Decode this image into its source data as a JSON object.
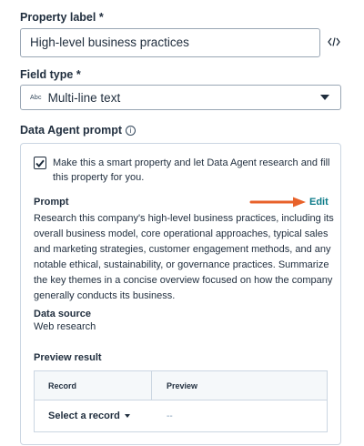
{
  "property_label": {
    "label": "Property label *",
    "value": "High-level business practices"
  },
  "field_type": {
    "label": "Field type *",
    "icon_text": "Abc",
    "value": "Multi-line text"
  },
  "agent": {
    "label": "Data Agent prompt",
    "smart_checkbox_checked": true,
    "smart_checkbox_text": "Make this a smart property and let Data Agent research and fill this property for you.",
    "prompt_title": "Prompt",
    "edit_label": "Edit",
    "prompt_text": "Research this company's high-level business practices, including its overall business model, core operational approaches, typical sales and marketing strategies, customer engagement methods, and any notable ethical, sustainability, or governance practices. Summarize the key themes in a concise overview focused on how the company generally conducts its business.",
    "data_source_title": "Data source",
    "data_source_value": "Web research",
    "preview_title": "Preview result",
    "table": {
      "col_record": "Record",
      "col_preview": "Preview",
      "select_record": "Select a record",
      "preview_value": "--"
    }
  },
  "colors": {
    "accent_link": "#0b7a88",
    "arrow": "#e8622a",
    "border": "#cbd6e2"
  }
}
